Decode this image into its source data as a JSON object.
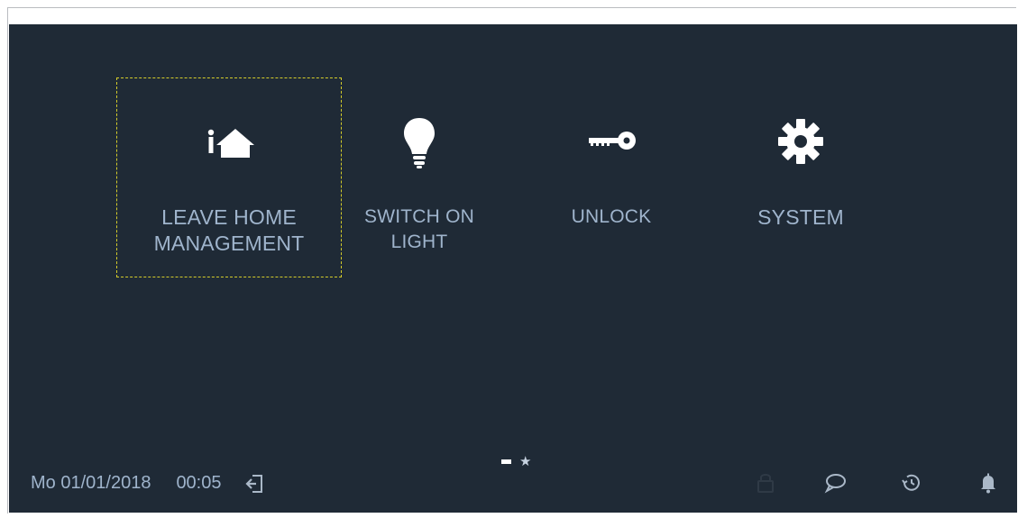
{
  "tiles": [
    {
      "label": "LEAVE HOME\nMANAGEMENT",
      "icon": "leave-home-icon",
      "selected": true
    },
    {
      "label": "SWITCH ON\nLIGHT",
      "icon": "light-bulb-icon",
      "selected": false
    },
    {
      "label": "UNLOCK",
      "icon": "key-icon",
      "selected": false
    },
    {
      "label": "SYSTEM",
      "icon": "gear-icon",
      "selected": false
    }
  ],
  "statusbar": {
    "date": "Mo 01/01/2018",
    "time": "00:05"
  },
  "pager": {
    "pages": [
      "dash",
      "star"
    ],
    "active_index": 0
  },
  "colors": {
    "screen_bg": "#1f2a36",
    "label": "#9fb4cc",
    "icon": "#ffffff",
    "selection": "#d4cc2a",
    "tray_icon": "#aab8c8",
    "tray_icon_dim": "#2f3a46"
  },
  "tray_icons": [
    "lock-icon",
    "message-icon",
    "history-icon",
    "bell-icon"
  ]
}
